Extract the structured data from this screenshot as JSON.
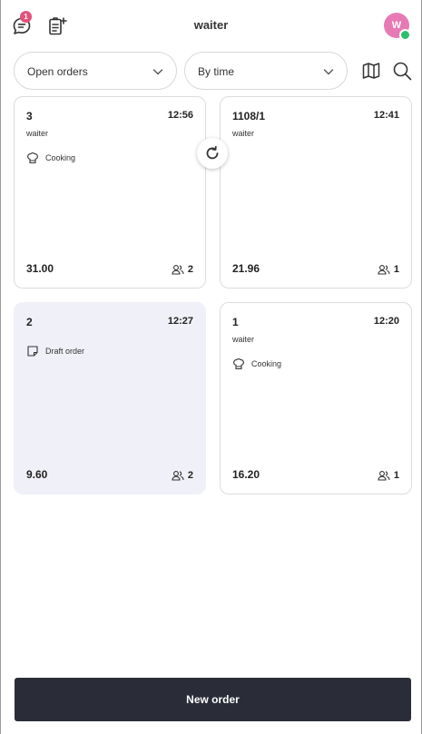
{
  "header": {
    "title": "waiter",
    "notification_count": "1",
    "avatar_initial": "W",
    "avatar_color": "#e77ab4",
    "status_color": "#2ebf6b",
    "icons": [
      "chat-icon",
      "new-checklist-icon"
    ]
  },
  "filters": {
    "order_filter": "Open orders",
    "sort": "By time",
    "icons": [
      "map-icon",
      "search-icon"
    ]
  },
  "orders": [
    {
      "number": "3",
      "time": "12:56",
      "user": "waiter",
      "status": "Cooking",
      "status_icon": "chef-hat-icon",
      "total": "31.00",
      "guests": "2"
    },
    {
      "number": "1108/1",
      "time": "12:41",
      "user": "waiter",
      "status": "",
      "status_icon": "",
      "total": "21.96",
      "guests": "1"
    },
    {
      "number": "2",
      "time": "12:27",
      "user": "",
      "status": "Draft order",
      "status_icon": "note-icon",
      "total": "9.60",
      "guests": "2"
    },
    {
      "number": "1",
      "time": "12:20",
      "user": "waiter",
      "status": "Cooking",
      "status_icon": "chef-hat-icon",
      "total": "16.20",
      "guests": "1"
    }
  ],
  "colors": {
    "accent_dark": "#2a2d37",
    "draft_card": "#f0f0f8",
    "badge": "#e4507a"
  },
  "footer": {
    "new_order_label": "New order"
  }
}
